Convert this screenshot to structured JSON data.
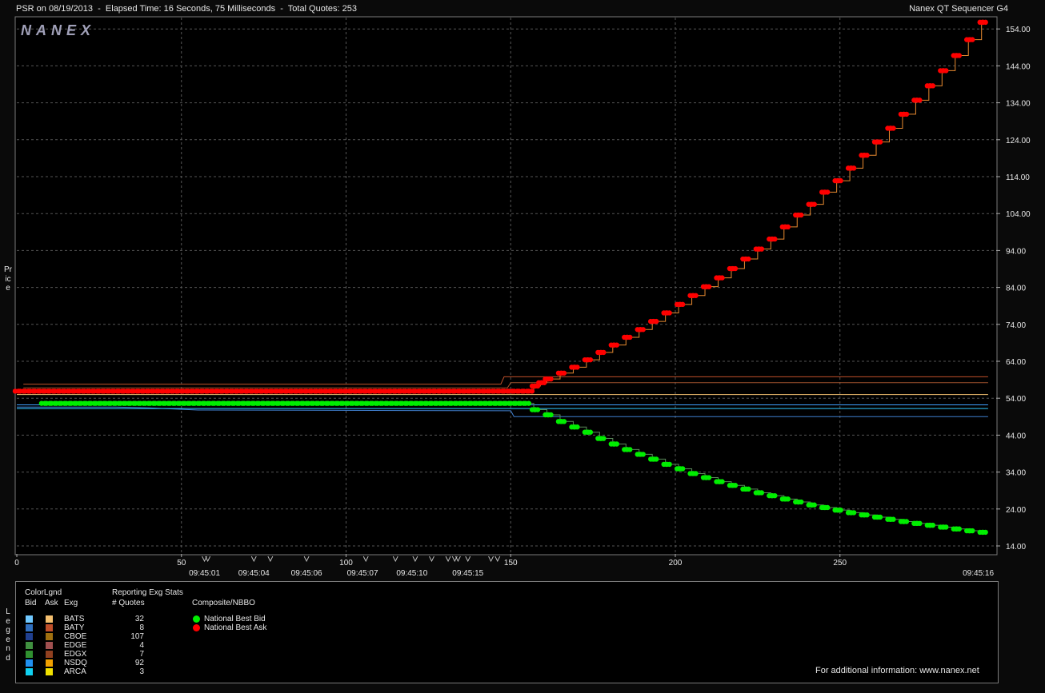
{
  "header": {
    "title_left": "PSR on 08/19/2013  -  Elapsed Time: 16 Seconds, 75 Milliseconds  -  Total Quotes: 253",
    "title_right": "Nanex QT Sequencer G4",
    "logo": "NANEX",
    "y_axis_label": "Price"
  },
  "chart_data": {
    "type": "scatter",
    "title": "PSR on 08/19/2013  -  Elapsed Time: 16 Seconds, 75 Milliseconds  -  Total Quotes: 253",
    "ylabel": "Price",
    "xlim": [
      0,
      298
    ],
    "ylim": [
      12.5,
      158.5
    ],
    "y_ticks": [
      "14.00",
      "24.00",
      "34.00",
      "44.00",
      "54.00",
      "64.00",
      "74.00",
      "84.00",
      "94.00",
      "104.00",
      "114.00",
      "124.00",
      "134.00",
      "144.00",
      "154.00"
    ],
    "y_tick_values": [
      14,
      24,
      34,
      44,
      54,
      64,
      74,
      84,
      94,
      104,
      114,
      124,
      134,
      144,
      154
    ],
    "x_ticks": [
      0,
      50,
      100,
      150,
      200,
      250
    ],
    "x_time_labels": [
      {
        "x": 57,
        "label": "09:45:01"
      },
      {
        "x": 72,
        "label": "09:45:04"
      },
      {
        "x": 88,
        "label": "09:45:06"
      },
      {
        "x": 105,
        "label": "09:45:07"
      },
      {
        "x": 120,
        "label": "09:45:10"
      },
      {
        "x": 137,
        "label": "09:45:15"
      },
      {
        "x": 292,
        "label": "09:45:16"
      }
    ],
    "time_markers_x": [
      57,
      58,
      72,
      77,
      88,
      106,
      115,
      121,
      126,
      131,
      133,
      134,
      137,
      144,
      146
    ],
    "grid": true,
    "series": [
      {
        "name": "National Best Ask",
        "color": "#ff0000",
        "flat": {
          "x_start": 0,
          "x_end": 156,
          "y": 55.9
        },
        "points": [
          [
            157,
            57.3
          ],
          [
            159,
            58.2
          ],
          [
            161,
            59.2
          ],
          [
            165,
            60.8
          ],
          [
            169,
            62.4
          ],
          [
            173,
            64.4
          ],
          [
            177,
            66.4
          ],
          [
            181,
            68.4
          ],
          [
            185,
            70.5
          ],
          [
            189,
            72.6
          ],
          [
            193,
            74.8
          ],
          [
            197,
            77.1
          ],
          [
            201,
            79.4
          ],
          [
            205,
            81.8
          ],
          [
            209,
            84.2
          ],
          [
            213,
            86.6
          ],
          [
            217,
            89.1
          ],
          [
            221,
            91.7
          ],
          [
            225,
            94.4
          ],
          [
            229,
            97.1
          ],
          [
            233,
            100.4
          ],
          [
            237,
            103.6
          ],
          [
            241,
            106.5
          ],
          [
            245,
            109.8
          ],
          [
            249,
            112.9
          ],
          [
            253,
            116.3
          ],
          [
            257,
            119.8
          ],
          [
            261,
            123.4
          ],
          [
            265,
            127.1
          ],
          [
            269,
            130.9
          ],
          [
            273,
            134.7
          ],
          [
            277,
            138.6
          ],
          [
            281,
            142.7
          ],
          [
            285,
            146.8
          ],
          [
            289,
            151.1
          ],
          [
            293,
            155.8
          ]
        ]
      },
      {
        "name": "National Best Bid",
        "color": "#00ee00",
        "flat": {
          "x_start": 8,
          "x_end": 156,
          "y": 52.6
        },
        "points": [
          [
            157,
            50.9
          ],
          [
            161,
            49.5
          ],
          [
            165,
            47.7
          ],
          [
            169,
            46.2
          ],
          [
            173,
            44.8
          ],
          [
            177,
            43.1
          ],
          [
            181,
            41.6
          ],
          [
            185,
            40.1
          ],
          [
            189,
            38.8
          ],
          [
            193,
            37.5
          ],
          [
            197,
            36.1
          ],
          [
            201,
            34.9
          ],
          [
            205,
            33.6
          ],
          [
            209,
            32.5
          ],
          [
            213,
            31.4
          ],
          [
            217,
            30.4
          ],
          [
            221,
            29.4
          ],
          [
            225,
            28.4
          ],
          [
            229,
            27.6
          ],
          [
            233,
            26.7
          ],
          [
            237,
            25.9
          ],
          [
            241,
            25.1
          ],
          [
            245,
            24.4
          ],
          [
            249,
            23.7
          ],
          [
            253,
            23.0
          ],
          [
            257,
            22.4
          ],
          [
            261,
            21.8
          ],
          [
            265,
            21.2
          ],
          [
            269,
            20.6
          ],
          [
            273,
            20.1
          ],
          [
            277,
            19.6
          ],
          [
            281,
            19.1
          ],
          [
            285,
            18.6
          ],
          [
            289,
            18.1
          ],
          [
            293,
            17.7
          ]
        ]
      }
    ],
    "exchange_lines": [
      {
        "exchange": "BATS",
        "side": "ask",
        "color": "#f4c070",
        "segments": [
          [
            [
              0,
              55.0
            ],
            [
              156,
              55.0
            ],
            [
              156,
              55.0
            ],
            [
              295,
              55.0
            ]
          ]
        ]
      },
      {
        "exchange": "BATY",
        "side": "ask",
        "color": "#c0502a",
        "segments": [
          [
            [
              2,
              57.8
            ],
            [
              147,
              57.8
            ],
            [
              148,
              59.8
            ],
            [
              295,
              59.8
            ]
          ]
        ]
      },
      {
        "exchange": "CBOE",
        "side": "ask",
        "color": "#a0522d",
        "segments": [
          [
            [
              2,
              56.8
            ],
            [
              149,
              56.8
            ],
            [
              150,
              58.2
            ],
            [
              295,
              58.2
            ]
          ]
        ]
      },
      {
        "exchange": "CBOE",
        "side": "bid",
        "color": "#4080d0",
        "segments": [
          [
            [
              0,
              51.6
            ],
            [
              30,
              51.6
            ],
            [
              40,
              51.4
            ],
            [
              55,
              50.8
            ],
            [
              150,
              50.6
            ],
            [
              151,
              49.0
            ],
            [
              295,
              49.0
            ]
          ]
        ]
      },
      {
        "exchange": "NSDQ",
        "side": "bid",
        "color": "#40a0ff",
        "segments": [
          [
            [
              0,
              52.2
            ],
            [
              156,
              52.2
            ],
            [
              295,
              52.2
            ]
          ]
        ]
      },
      {
        "exchange": "ARCA",
        "side": "bid",
        "color": "#30c8ff",
        "segments": [
          [
            [
              0,
              51.2
            ],
            [
              150,
              51.2
            ],
            [
              295,
              51.2
            ]
          ]
        ]
      }
    ]
  },
  "legend": {
    "vertical_label": "Legend",
    "color_legend_title": "ColorLgnd",
    "col_bid": "Bid",
    "col_ask": "Ask",
    "col_exg": "Exg",
    "stats_title": "Reporting Exg Stats",
    "stats_col": "# Quotes",
    "composite_title": "Composite/NBBO",
    "composite_items": [
      {
        "label": "National Best Bid",
        "color": "#00ee00"
      },
      {
        "label": "National Best Ask",
        "color": "#ff0000"
      }
    ],
    "exchanges": [
      {
        "exg": "BATS",
        "quotes": "32",
        "bid_color": "#70c8ff",
        "ask_color": "#f4c070"
      },
      {
        "exg": "BATY",
        "quotes": "8",
        "bid_color": "#3070c0",
        "ask_color": "#c0502a"
      },
      {
        "exg": "CBOE",
        "quotes": "107",
        "bid_color": "#204090",
        "ask_color": "#a07010"
      },
      {
        "exg": "EDGE",
        "quotes": "4",
        "bid_color": "#409040",
        "ask_color": "#a05050"
      },
      {
        "exg": "EDGX",
        "quotes": "7",
        "bid_color": "#309030",
        "ask_color": "#904020"
      },
      {
        "exg": "NSDQ",
        "quotes": "92",
        "bid_color": "#2090f0",
        "ask_color": "#f0a000"
      },
      {
        "exg": "ARCA",
        "quotes": "3",
        "bid_color": "#10d0f0",
        "ask_color": "#f0e000"
      }
    ],
    "footer": "For additional information: www.nanex.net"
  }
}
